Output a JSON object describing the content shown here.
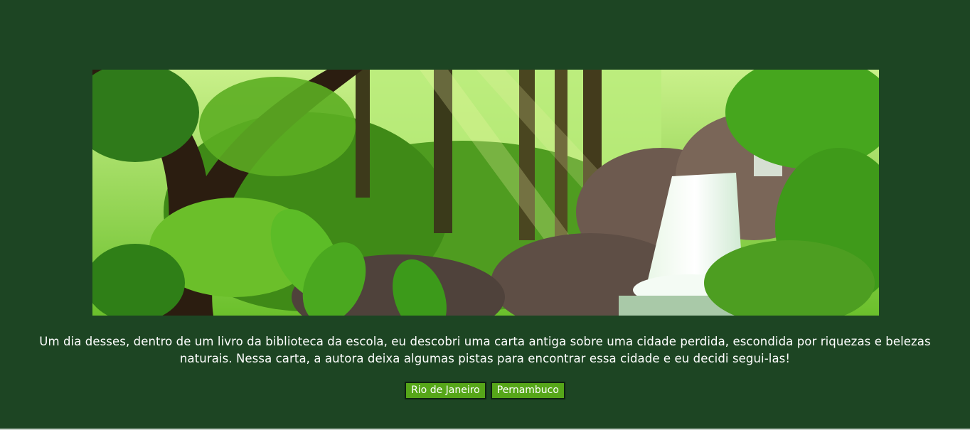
{
  "hero": {
    "image_alt": "Ilustração de floresta tropical com cachoeira"
  },
  "story": {
    "text": "Um dia desses, dentro de um livro da biblioteca da escola, eu descobri uma carta antiga sobre uma cidade perdida, escondida por riquezas e belezas naturais. Nessa carta, a autora deixa algumas pistas para encontrar essa cidade e eu decidi segui-las!"
  },
  "choices": [
    {
      "label": "Rio de Janeiro"
    },
    {
      "label": "Pernambuco"
    }
  ],
  "colors": {
    "background": "#1d4523",
    "button": "#56a619",
    "text": "#ffffff"
  }
}
